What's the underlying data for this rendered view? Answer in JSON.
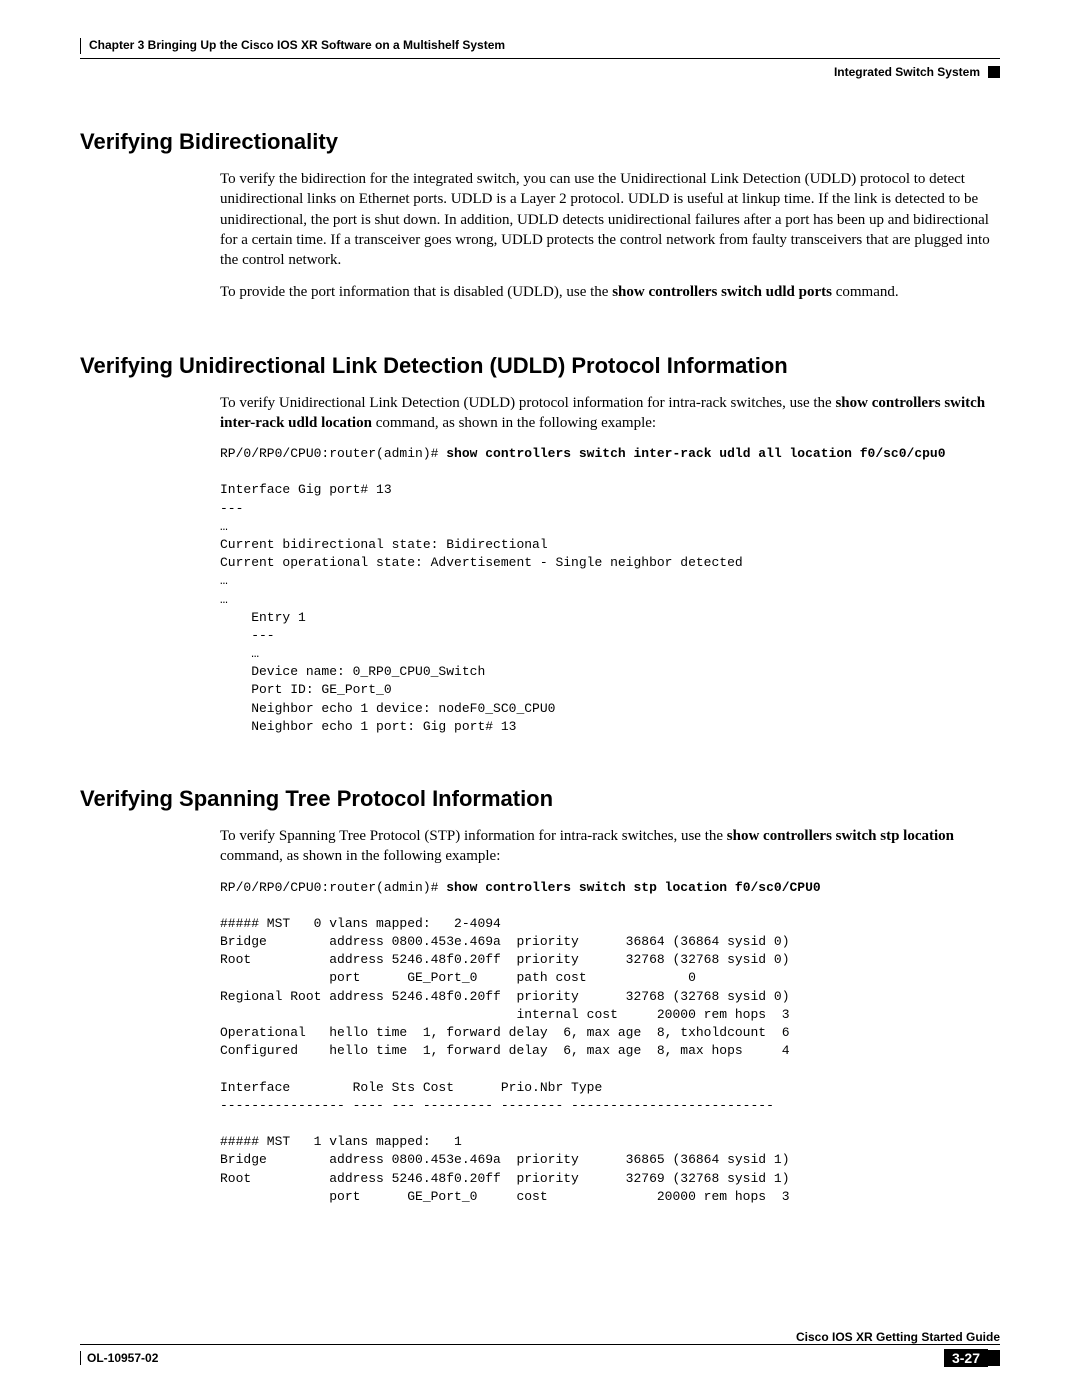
{
  "header": {
    "chapter_line": "Chapter 3    Bringing Up the Cisco IOS XR Software on a Multishelf System",
    "right_label": "Integrated Switch System"
  },
  "sections": {
    "bidi": {
      "title": "Verifying Bidirectionality",
      "p1": "To verify the bidirection for the integrated switch, you can use the Unidirectional Link Detection (UDLD) protocol to detect unidirectional links on Ethernet ports. UDLD is a Layer 2 protocol. UDLD is useful at linkup time. If the link is detected to be unidirectional, the port is shut down. In addition, UDLD detects unidirectional failures after a port has been up and bidirectional for a certain time. If a transceiver goes wrong, UDLD protects the control network from faulty transceivers that are plugged into the control network.",
      "p2a": "To provide the port information that is disabled (UDLD), use the ",
      "p2b": "show controllers switch udld ports",
      "p2c": " command."
    },
    "udld": {
      "title": "Verifying Unidirectional Link Detection (UDLD) Protocol Information",
      "p1a": "To verify Unidirectional Link Detection (UDLD) protocol information for intra-rack switches, use the ",
      "p1b": "show controllers switch inter-rack udld location",
      "p1c": " command, as shown in the following example:",
      "code_prompt": "RP/0/RP0/CPU0:router(admin)# ",
      "code_cmd": "show controllers switch inter-rack udld all location f0/sc0/cpu0",
      "code_body": "Interface Gig port# 13\n---\n…\nCurrent bidirectional state: Bidirectional\nCurrent operational state: Advertisement - Single neighbor detected\n…\n…\n    Entry 1\n    ---\n    …\n    Device name: 0_RP0_CPU0_Switch\n    Port ID: GE_Port_0\n    Neighbor echo 1 device: nodeF0_SC0_CPU0\n    Neighbor echo 1 port: Gig port# 13"
    },
    "stp": {
      "title": "Verifying Spanning Tree Protocol Information",
      "p1a": "To verify Spanning Tree Protocol (STP) information for intra-rack switches, use the ",
      "p1b": "show controllers switch stp location",
      "p1c": " command, as shown in the following example:",
      "code_prompt": "RP/0/RP0/CPU0:router(admin)# ",
      "code_cmd": "show controllers switch stp location f0/sc0/CPU0",
      "code_body": "##### MST   0 vlans mapped:   2-4094\nBridge        address 0800.453e.469a  priority      36864 (36864 sysid 0)\nRoot          address 5246.48f0.20ff  priority      32768 (32768 sysid 0)\n              port      GE_Port_0     path cost             0\nRegional Root address 5246.48f0.20ff  priority      32768 (32768 sysid 0)\n                                      internal cost     20000 rem hops  3\nOperational   hello time  1, forward delay  6, max age  8, txholdcount  6\nConfigured    hello time  1, forward delay  6, max age  8, max hops     4\n\nInterface        Role Sts Cost      Prio.Nbr Type                      \n---------------- ---- --- --------- -------- --------------------------\n\n##### MST   1 vlans mapped:   1\nBridge        address 0800.453e.469a  priority      36865 (36864 sysid 1)\nRoot          address 5246.48f0.20ff  priority      32769 (32768 sysid 1)\n              port      GE_Port_0     cost              20000 rem hops  3"
    }
  },
  "footer": {
    "guide": "Cisco IOS XR Getting Started Guide",
    "docid": "OL-10957-02",
    "pagenum": "3-27"
  }
}
